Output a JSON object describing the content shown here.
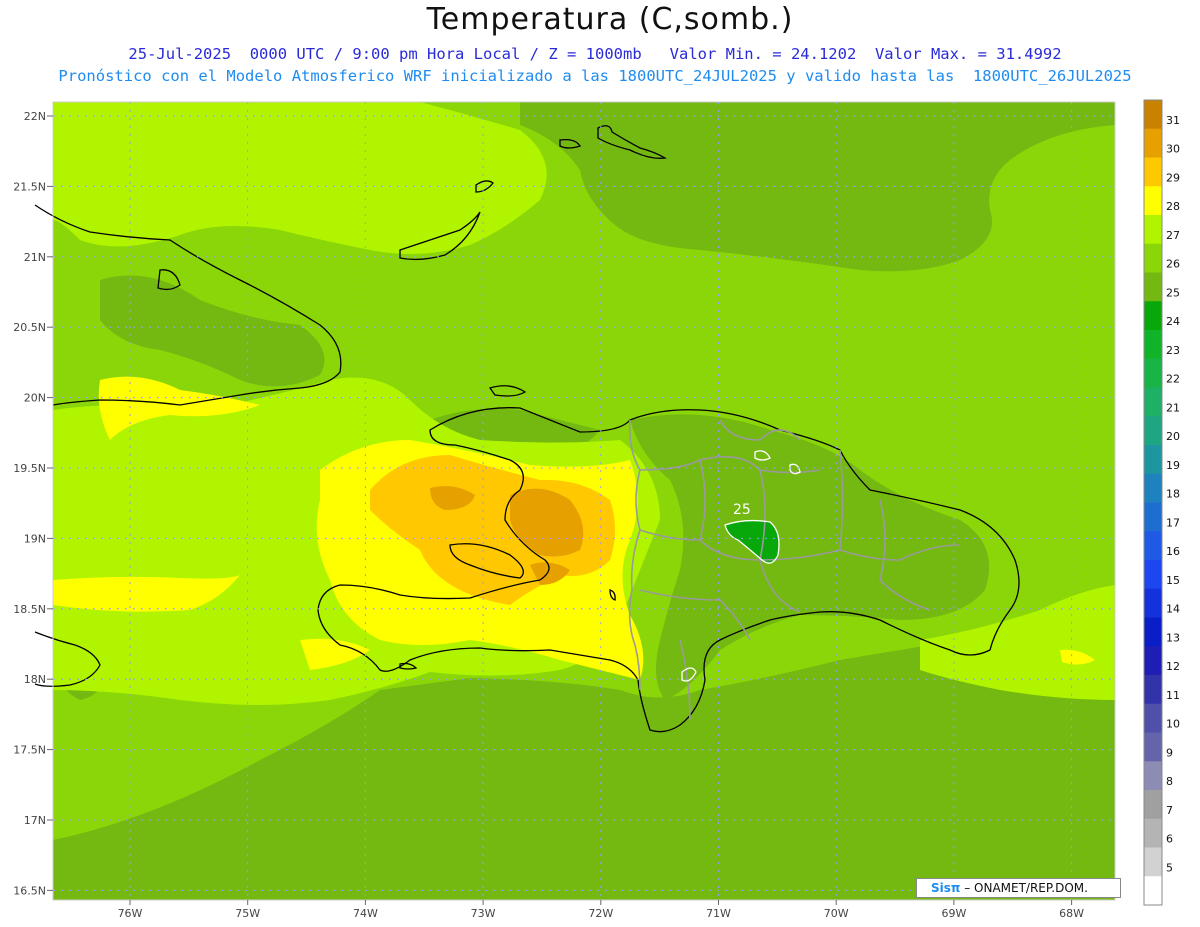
{
  "header": {
    "title": "Temperatura (C,somb.)",
    "line1": "25-Jul-2025  0000 UTC / 9:00 pm Hora Local / Z = 1000mb   Valor Min. = 24.1202  Valor Max. = 31.4992",
    "line2": "Pronóstico con el Modelo Atmosferico WRF inicializado a las 1800UTC_24JUL2025 y valido hasta las  1800UTC_26JUL2025"
  },
  "axes": {
    "lat_labels": [
      "22N",
      "21.5N",
      "21N",
      "20.5N",
      "20N",
      "19.5N",
      "19N",
      "18.5N",
      "18N",
      "17.5N",
      "17N",
      "16.5N"
    ],
    "lon_labels": [
      "76W",
      "75W",
      "74W",
      "73W",
      "72W",
      "71W",
      "70W",
      "69W",
      "68W"
    ]
  },
  "map": {
    "contour_label": "25",
    "field": "temperature_1000mb",
    "colors": {
      "t24": "#08a80a",
      "t25": "#74b812",
      "t26": "#8ad608",
      "t27": "#b0f400",
      "t28": "#ffff00",
      "t29": "#ffc800",
      "t30": "#e6a000",
      "t31": "#c88200"
    }
  },
  "colorbar": {
    "levels": [
      "31",
      "30",
      "29",
      "28",
      "27",
      "26",
      "25",
      "24",
      "23",
      "22",
      "21",
      "20",
      "19",
      "18",
      "17",
      "16",
      "15",
      "14",
      "13",
      "12",
      "11",
      "10",
      "9",
      "8",
      "7",
      "6",
      "5"
    ],
    "colors": [
      "#c88200",
      "#e6a000",
      "#ffc800",
      "#ffff00",
      "#b0f400",
      "#8ad608",
      "#74b812",
      "#08a80a",
      "#10b428",
      "#18b446",
      "#1eb064",
      "#1ea582",
      "#1e96a0",
      "#1e82be",
      "#1e6ed2",
      "#1e5ae6",
      "#1e46f0",
      "#1432dc",
      "#0a1ec8",
      "#1e1eb4",
      "#3232aa",
      "#5050aa",
      "#6464aa",
      "#8c8cb4",
      "#a0a0a0",
      "#b4b4b4",
      "#d2d2d2",
      "#ffffff"
    ]
  },
  "credit": {
    "brand": "Sisπ",
    "org": "– ONAMET/REP.DOM."
  }
}
